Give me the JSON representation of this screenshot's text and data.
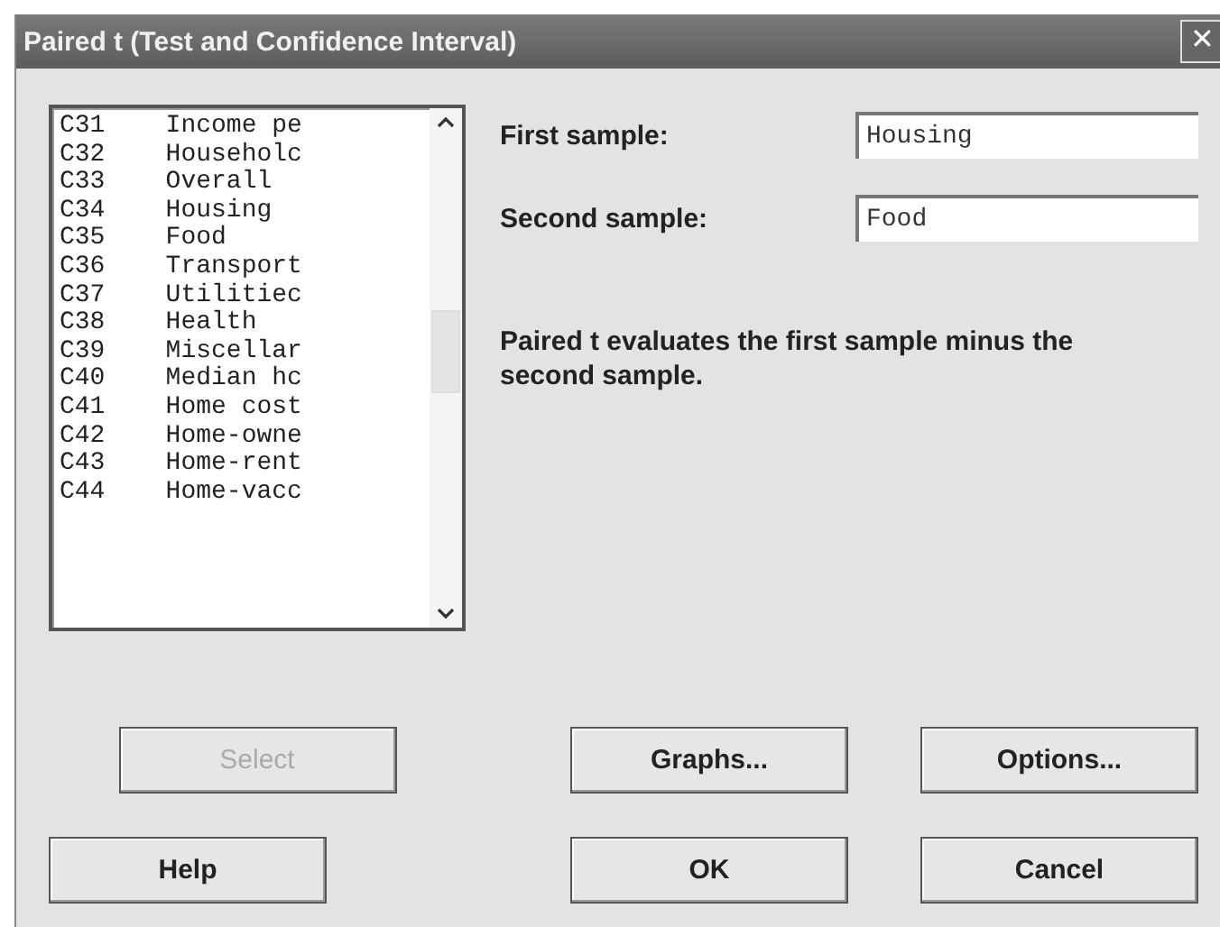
{
  "window": {
    "title": "Paired t (Test and Confidence Interval)",
    "close": "✕"
  },
  "columns_list": [
    {
      "id": "C31",
      "name": "Income pe"
    },
    {
      "id": "C32",
      "name": "Householc"
    },
    {
      "id": "C33",
      "name": "Overall"
    },
    {
      "id": "C34",
      "name": "Housing"
    },
    {
      "id": "C35",
      "name": "Food"
    },
    {
      "id": "C36",
      "name": "Transport"
    },
    {
      "id": "C37",
      "name": "Utilitiec"
    },
    {
      "id": "C38",
      "name": "Health"
    },
    {
      "id": "C39",
      "name": "Miscellar"
    },
    {
      "id": "C40",
      "name": "Median hc"
    },
    {
      "id": "C41",
      "name": "Home cost"
    },
    {
      "id": "C42",
      "name": "Home-owne"
    },
    {
      "id": "C43",
      "name": "Home-rent"
    },
    {
      "id": "C44",
      "name": "Home-vacc"
    }
  ],
  "fields": [
    {
      "label": "First sample:",
      "value": "Housing"
    },
    {
      "label": "Second sample:",
      "value": "Food"
    }
  ],
  "note": "Paired t evaluates the first sample minus the second sample.",
  "buttons_row1": [
    {
      "label": "Select",
      "disabled": true
    },
    {
      "label": "Graphs...",
      "disabled": false
    },
    {
      "label": "Options...",
      "disabled": false
    }
  ],
  "buttons_row2": [
    {
      "label": "Help",
      "disabled": false
    },
    {
      "label": "OK",
      "disabled": false
    },
    {
      "label": "Cancel",
      "disabled": false
    }
  ]
}
